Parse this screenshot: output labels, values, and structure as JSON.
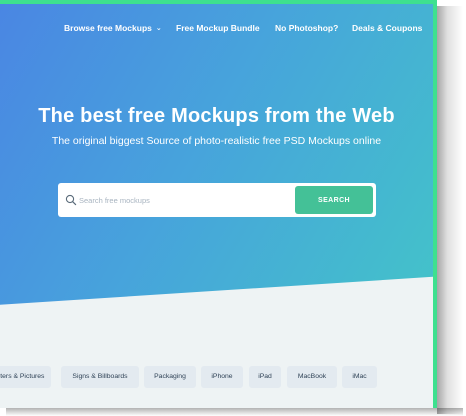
{
  "nav": {
    "items": [
      {
        "label": "Browse free Mockups",
        "dropdown": true
      },
      {
        "label": "Free Mockup Bundle"
      },
      {
        "label": "No Photoshop?"
      },
      {
        "label": "Deals & Coupons"
      }
    ],
    "dropdown_icon": "chevron-down-icon"
  },
  "hero": {
    "title": "The best free Mockups from the Web",
    "subtitle": "The original biggest Source of photo-realistic free PSD Mockups online"
  },
  "search": {
    "placeholder": "Search free mockups",
    "value": "",
    "icon": "search-icon",
    "button_label": "SEARCH"
  },
  "categories": [
    "Posters & Pictures",
    "Signs & Billboards",
    "Packaging",
    "iPhone",
    "iPad",
    "MacBook",
    "iMac"
  ],
  "colors": {
    "accent_border": "#3ee08f",
    "hero_gradient_start": "#4a86e3",
    "hero_gradient_end": "#43c3c9",
    "search_button": "#44c197",
    "chip_bg": "#e3eaf0"
  }
}
